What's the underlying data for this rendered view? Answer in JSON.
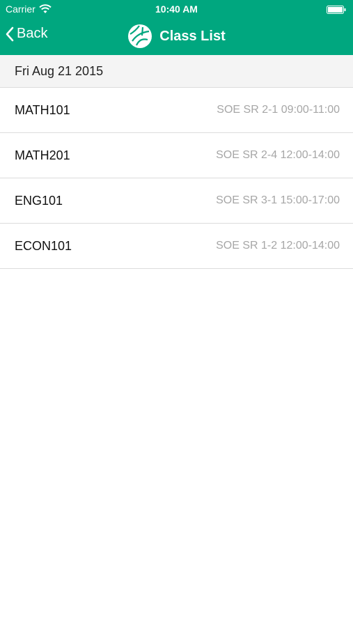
{
  "status_bar": {
    "carrier": "Carrier",
    "time": "10:40 AM",
    "wifi_icon": "wifi-icon",
    "battery_icon": "battery-icon"
  },
  "nav": {
    "back_label": "Back",
    "title": "Class List",
    "logo_icon": "school-logo-icon",
    "accent_color": "#00a77f"
  },
  "section": {
    "date": "Fri Aug 21 2015"
  },
  "classes": [
    {
      "name": "MATH101",
      "detail": "SOE SR 2-1 09:00-11:00"
    },
    {
      "name": "MATH201",
      "detail": "SOE SR 2-4 12:00-14:00"
    },
    {
      "name": "ENG101",
      "detail": "SOE SR 3-1 15:00-17:00"
    },
    {
      "name": "ECON101",
      "detail": "SOE SR 1-2 12:00-14:00"
    }
  ]
}
